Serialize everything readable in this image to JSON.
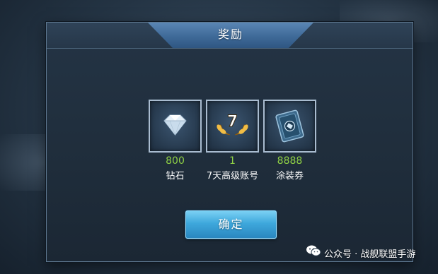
{
  "dialog": {
    "title": "奖励",
    "rewards": [
      {
        "quantity": "800",
        "name": "钻石",
        "icon": "diamond-icon"
      },
      {
        "quantity": "1",
        "name": "7天高级账号",
        "icon": "premium-7-days-icon",
        "badge": "7"
      },
      {
        "quantity": "8888",
        "name": "涂装券",
        "icon": "camouflage-ticket-icon"
      }
    ],
    "confirm_label": "确定"
  },
  "watermark": {
    "text": "公众号 · 战舰联盟手游",
    "icon": "wechat-icon"
  },
  "colors": {
    "quantity_green": "#8fd045",
    "title_tab_blue": "#4a78a8",
    "button_blue": "#3ea8dc"
  }
}
